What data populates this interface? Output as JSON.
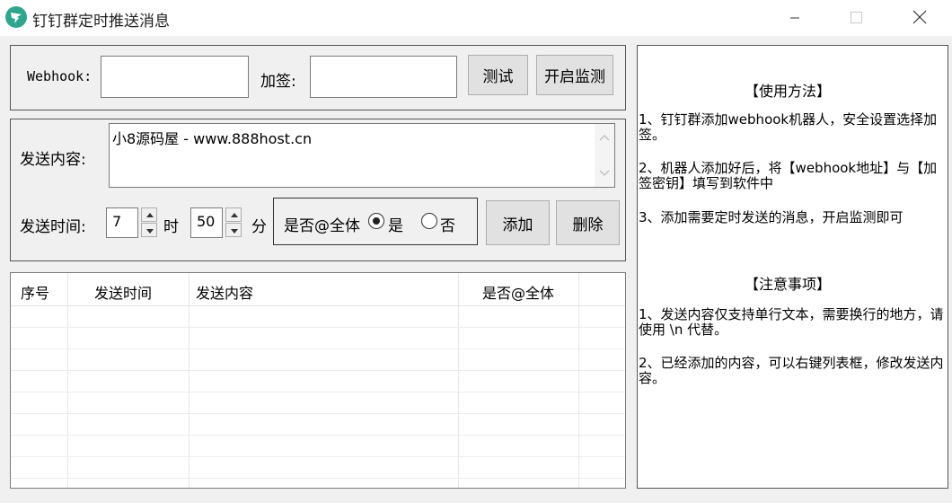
{
  "window": {
    "title": "钉钉群定时推送消息"
  },
  "config": {
    "webhook_label": "Webhook:",
    "webhook_value": "",
    "sign_label": "加签:",
    "sign_value": "",
    "test_button": "测试",
    "monitor_button": "开启监测"
  },
  "message": {
    "content_label": "发送内容:",
    "content_value": "小8源码屋 - www.888host.cn",
    "time_label": "发送时间:",
    "hour_value": "7",
    "hour_unit": "时",
    "minute_value": "50",
    "minute_unit": "分",
    "at_all_label": "是否@全体",
    "at_all_yes": "是",
    "at_all_no": "否",
    "at_all_selected": "是",
    "add_button": "添加",
    "delete_button": "删除"
  },
  "table": {
    "columns": [
      "序号",
      "发送时间",
      "发送内容",
      "是否@全体"
    ],
    "rows": []
  },
  "help": {
    "usage_title": "【使用方法】",
    "usage_items": [
      "1、钉钉群添加webhook机器人，安全设置选择加签。",
      "2、机器人添加好后，将【webhook地址】与【加签密钥】填写到软件中",
      "3、添加需要定时发送的消息，开启监测即可"
    ],
    "notes_title": "【注意事项】",
    "notes_items": [
      "1、发送内容仅支持单行文本，需要换行的地方，请使用 \\n 代替。",
      "2、已经添加的内容，可以右键列表框，修改发送内容。"
    ]
  },
  "colors": {
    "icon_bg": "#2fa58e",
    "window_bg": "#f0f0f0",
    "button_bg": "#e1e1e1"
  }
}
